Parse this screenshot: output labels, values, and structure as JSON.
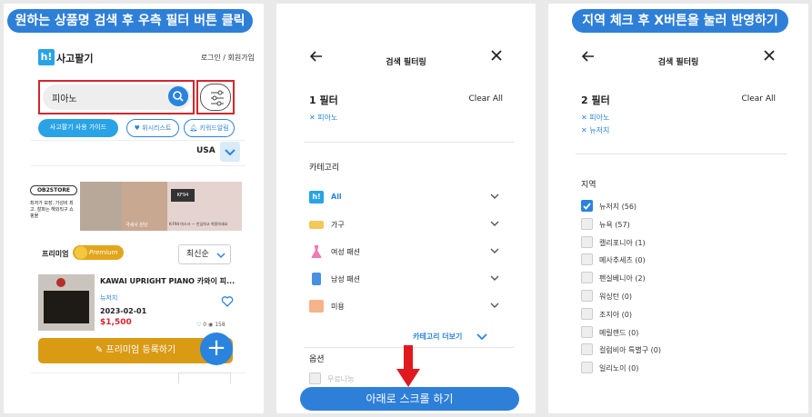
{
  "colors": {
    "accent": "#2a83de",
    "callout": "#2e7fd8",
    "highlight": "#d4262e",
    "premium": "#d99a14"
  },
  "panel1": {
    "callout": "원하는 상품명 검색 후 우측 필터 버튼 클릭",
    "logo": "h!",
    "app_name": "사고팔기",
    "login": "로그인 / 회원가입",
    "search_value": "피아노",
    "chips": [
      "사고팔기 사용 가이드",
      "위시리스트",
      "키워드알림"
    ],
    "region": "USA",
    "banner": {
      "store": "OB2STORE",
      "small_text": "최저가 보장. 가성비 최고. 잘파는 해외직구 쇼핑몰",
      "sub": "K-F94 마스크 — 안심하고 착용하세요",
      "mid": "극세사 원단"
    },
    "premium_label": "프리미엄",
    "premium_badge": "Premium",
    "sort": "최신순",
    "item": {
      "title": "KAWAI UPRIGHT PIANO 카와이 피...",
      "location": "뉴저지",
      "date": "2023-02-01",
      "price": "$1,500",
      "likes": "0",
      "views": "158"
    },
    "register_button": "프리미엄 등록하기"
  },
  "panel2": {
    "title": "검색 필터링",
    "count": "1 필터",
    "clear": "Clear All",
    "tags": [
      "피아노"
    ],
    "category_heading": "카테고리",
    "categories": [
      "All",
      "가구",
      "여성 패션",
      "남성 패션",
      "미용"
    ],
    "more": "카테고리 더보기",
    "options_heading": "옵션",
    "option_partial": "무료나눔",
    "bottom_callout": "아래로 스크롤 하기"
  },
  "panel3": {
    "callout": "지역 체크 후 X버튼을 눌러 반영하기",
    "title": "검색 필터링",
    "count": "2 필터",
    "clear": "Clear All",
    "tags": [
      "피아노",
      "뉴저지"
    ],
    "region_heading": "지역",
    "regions": [
      {
        "label": "뉴저지 (56)",
        "checked": true
      },
      {
        "label": "뉴욕 (57)",
        "checked": false
      },
      {
        "label": "캘리포니아 (1)",
        "checked": false
      },
      {
        "label": "메사추세츠 (0)",
        "checked": false
      },
      {
        "label": "펜실베니아 (2)",
        "checked": false
      },
      {
        "label": "워싱턴 (0)",
        "checked": false
      },
      {
        "label": "조지아 (0)",
        "checked": false
      },
      {
        "label": "메릴랜드 (0)",
        "checked": false
      },
      {
        "label": "컬럼비아 특별구 (0)",
        "checked": false
      },
      {
        "label": "일리노이 (0)",
        "checked": false
      }
    ]
  }
}
